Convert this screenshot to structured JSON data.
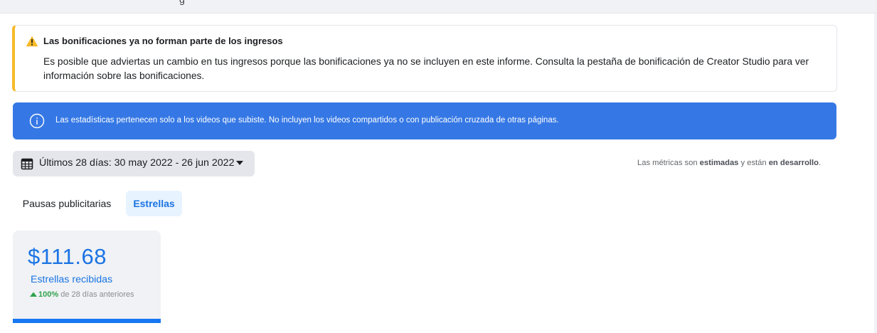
{
  "header": {
    "title_fragment": "g"
  },
  "warning": {
    "icon": "warning-triangle-icon",
    "accent_color": "#f7b928",
    "title": "Las bonificaciones ya no forman parte de los ingresos",
    "body": "Es posible que adviertas un cambio en tus ingresos porque las bonificaciones ya no se incluyen en este informe. Consulta la pestaña de bonificación de Creator Studio para ver información sobre las bonificaciones."
  },
  "info_banner": {
    "icon": "info-circle-icon",
    "background_color": "#3578e5",
    "text": "Las estadísticas pertenecen solo a los videos que subiste. No incluyen los videos compartidos o con publicación cruzada de otras páginas."
  },
  "date_range": {
    "icon": "calendar-icon",
    "label": "Últimos 28 días: 30 may 2022 - 26 jun 2022",
    "dropdown_icon": "caret-down-icon"
  },
  "metrics_note": {
    "prefix": "Las métricas son ",
    "estimated": "estimadas",
    "middle": " y están ",
    "in_dev": "en desarrollo",
    "suffix": "."
  },
  "tabs": [
    {
      "label": "Pausas publicitarias",
      "active": false
    },
    {
      "label": "Estrellas",
      "active": true
    }
  ],
  "stat_card": {
    "amount": "$111.68",
    "label": "Estrellas recibidas",
    "change_pct": "100%",
    "change_suffix": " de 28 días anteriores",
    "change_direction": "up",
    "accent_color": "#1877f2",
    "positive_color": "#31a24c"
  }
}
